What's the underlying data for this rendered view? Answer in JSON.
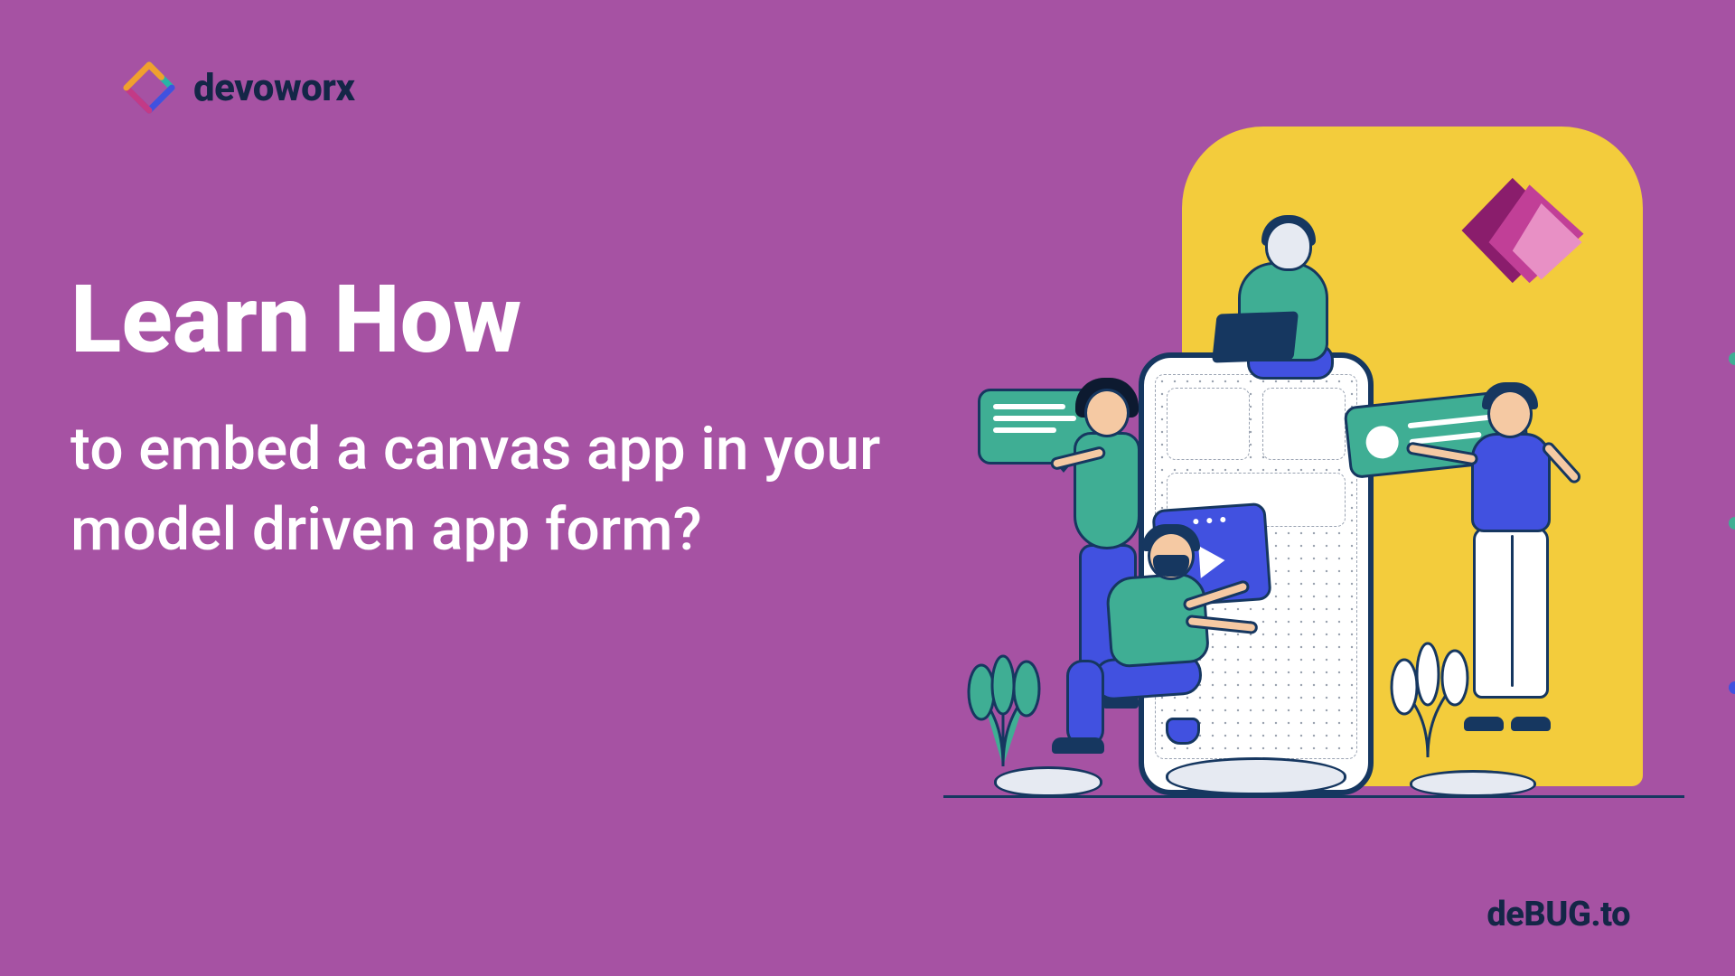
{
  "brand_top": {
    "name": "devoworx"
  },
  "brand_bottom": {
    "name": "deBUG.to"
  },
  "headline": {
    "lead": "Learn How",
    "sub": "to embed a canvas app in your model driven app form?"
  },
  "icons": {
    "logo_mark": "devoworx-diamond-icon",
    "powerapps": "power-apps-icon",
    "play": "play-icon"
  },
  "colors": {
    "background": "#A652A3",
    "accent_yellow": "#F3CC3C",
    "teal": "#3FAE94",
    "indigo": "#4151E0",
    "ink": "#163760",
    "pink_dark": "#B43A8E",
    "pink_light": "#E890C5"
  }
}
